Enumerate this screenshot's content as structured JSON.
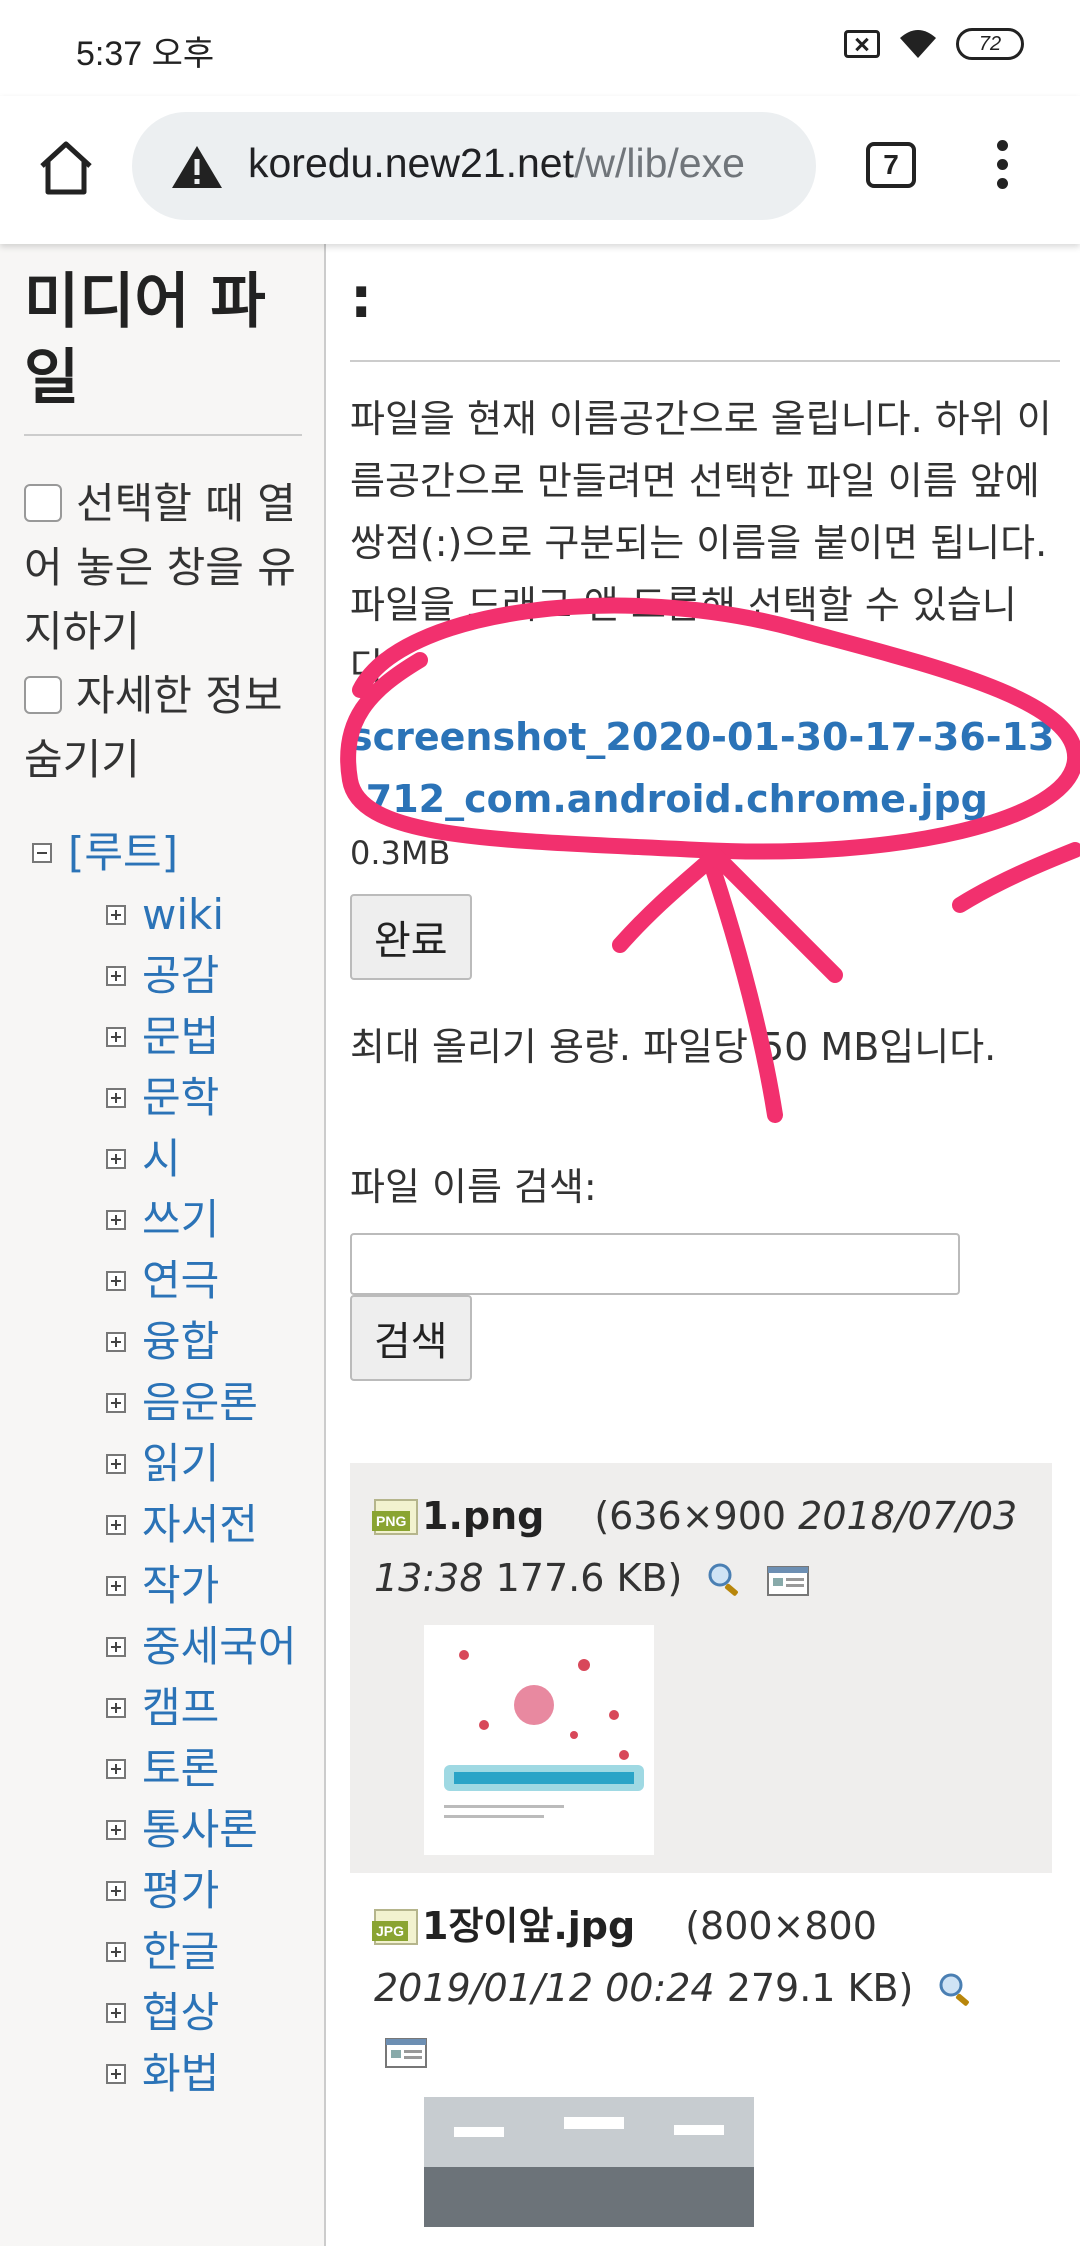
{
  "status": {
    "time": "5:37 오후",
    "battery": "72"
  },
  "browser": {
    "url_host": "koredu.new21.net",
    "url_path": "/w/lib/exe",
    "tab_count": "7"
  },
  "sidebar": {
    "title": "미디어 파일",
    "options": [
      {
        "label": "선택할 때 열어 놓은 창을 유지하기"
      },
      {
        "label": "자세한 정보 숨기기"
      }
    ],
    "root": "[루트]",
    "items": [
      "wiki",
      "공감",
      "문법",
      "문학",
      "시",
      "쓰기",
      "연극",
      "융합",
      "음운론",
      "읽기",
      "자서전",
      "작가",
      "중세국어",
      "캠프",
      "토론",
      "통사론",
      "평가",
      "한글",
      "협상",
      "화법"
    ]
  },
  "main": {
    "title": ":",
    "intro": "파일을 현재 이름공간으로 올립니다. 하위 이름공간으로 만들려면 선택한 파일 이름 앞에 쌍점(:)으로 구분되는 이름을 붙이면 됩니다. 파일을 드래그 앤 드롭해 선택할 수 있습니다.",
    "selected_file": "screenshot_2020-01-30-17-36-13-712_com.android.chrome.jpg",
    "selected_size": "0.3MB",
    "done_label": "완료",
    "max_upload": "최대 올리기 용량. 파일당 50 MB입니다.",
    "search_label": "파일 이름 검색:",
    "search_value": "",
    "search_button": "검색",
    "files": [
      {
        "type": "PNG",
        "name": "1.png",
        "dims": "(636×900 ",
        "date": "2018/07/03 13:38",
        "size": " 177.6 KB)"
      },
      {
        "type": "JPG",
        "name": "1장이앞.jpg",
        "dims": "(800×800 ",
        "date": "2019/01/12 00:24",
        "size": " 279.1 KB)"
      }
    ]
  },
  "colors": {
    "link": "#2b73b7",
    "annotation": "#f2306e"
  }
}
